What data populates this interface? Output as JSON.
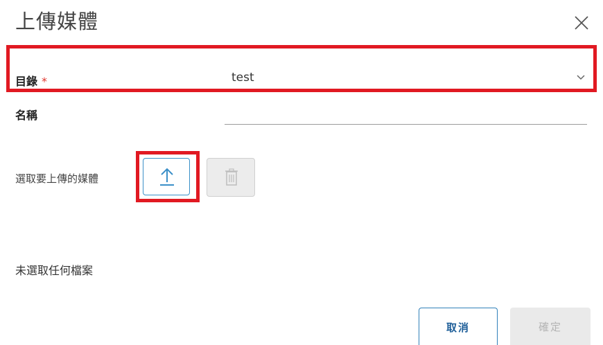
{
  "dialog": {
    "title": "上傳媒體"
  },
  "directory": {
    "label": "目錄",
    "required_mark": "*",
    "value": "test"
  },
  "name": {
    "label": "名稱",
    "value": ""
  },
  "media": {
    "label": "選取要上傳的媒體"
  },
  "status": {
    "no_file": "未選取任何檔案"
  },
  "footer": {
    "cancel_label": "取消",
    "ok_label": "確定"
  },
  "colors": {
    "highlight": "#e11922",
    "accent": "#3a8fc8",
    "required": "#e0362e"
  },
  "icons": {
    "close": "close-icon",
    "chevron": "chevron-down-icon",
    "upload": "upload-arrow-icon",
    "delete": "trash-icon"
  }
}
